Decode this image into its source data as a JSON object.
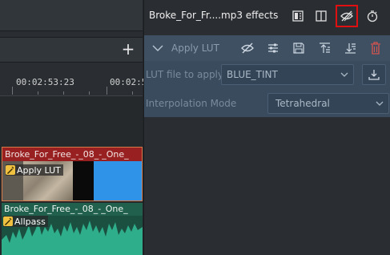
{
  "timeline": {
    "add_icon": "plus-icon",
    "ruler": {
      "timecode_1": "00:02:53:23",
      "timecode_2": "00:02:5"
    },
    "video_clip": {
      "title": "Broke_For_Free_-_08_-_One_",
      "effect_label": "Apply LUT",
      "effect_icon": "effect-badge-icon"
    },
    "audio_clip": {
      "title": "Broke_For_Free_-_08_-_One_",
      "effect_label": "Allpass",
      "effect_icon": "effect-badge-icon"
    }
  },
  "effects_panel": {
    "title": "Broke_For_Fr....mp3 effects",
    "header_buttons": [
      "compare-split-icon",
      "split-view-icon",
      "disable-effects-icon",
      "timer-icon"
    ],
    "effect": {
      "name": "Apply LUT",
      "collapsed": false,
      "buttons": [
        "visibility-off-icon",
        "sliders-icon",
        "save-icon",
        "move-up-icon",
        "move-down-icon",
        "delete-icon"
      ],
      "params": {
        "lut_label": "LUT file to apply",
        "lut_value": "BLUE_TINT",
        "interp_label": "Interpolation Mode",
        "interp_value": "Tetrahedral"
      }
    }
  },
  "colors": {
    "video_title_bg": "#992020",
    "video_border": "#d77a4a",
    "audio_bg": "#1f5a48",
    "effect_panel_bg": "#3a4b5d",
    "highlight_red": "#e01010",
    "delete_red": "#d9534f"
  }
}
